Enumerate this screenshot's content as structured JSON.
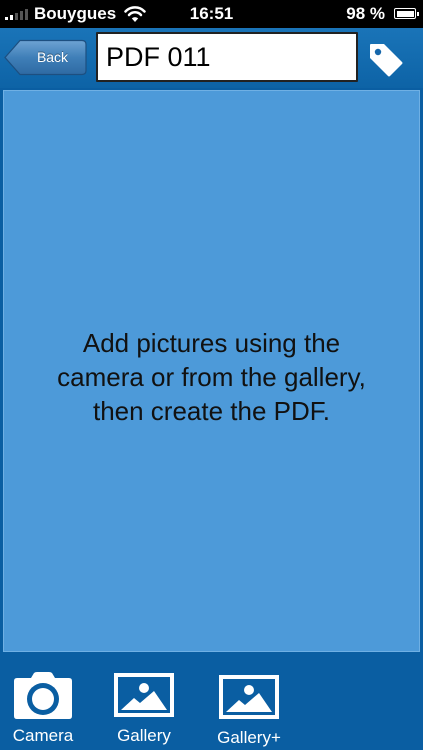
{
  "status_bar": {
    "carrier": "Bouygues",
    "time": "16:51",
    "battery": "98 %"
  },
  "nav": {
    "back_label": "Back",
    "title_value": "PDF 011"
  },
  "content": {
    "hint": "Add pictures using the camera or from the gallery, then create the PDF."
  },
  "toolbar": {
    "camera_label": "Camera",
    "gallery_label": "Gallery",
    "gallery_plus_label": "Gallery+"
  },
  "icons": {
    "signal": "signal-strength-icon",
    "wifi": "wifi-icon",
    "battery": "battery-icon",
    "tag": "tag-icon",
    "camera": "camera-icon",
    "gallery": "image-icon"
  },
  "colors": {
    "background": "#0a5ea2",
    "panel": "#4d9ad9",
    "nav": "#1a74b8",
    "back_button": "#3f7fb8"
  }
}
